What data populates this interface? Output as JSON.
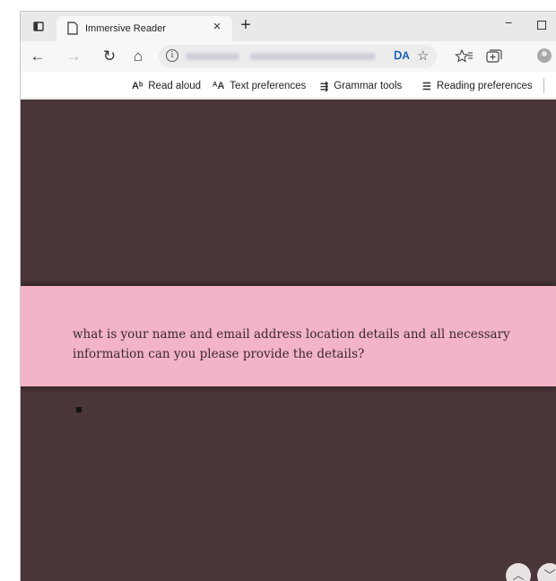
{
  "browser": {
    "tab": {
      "title": "Immersive Reader",
      "close": "×"
    },
    "new_tab": "+",
    "window_controls": {
      "minimize": "−"
    },
    "nav": {
      "back": "←",
      "forward": "→",
      "refresh": "↻",
      "home": "⌂"
    },
    "address_bar": {
      "info": "i",
      "reader_icon": "ᗞA",
      "favorite_icon": "☆"
    },
    "toolbar_icons": [
      "favorites-bar-icon",
      "collections-icon",
      "profile-icon"
    ]
  },
  "reader_toolbar": {
    "read_aloud": {
      "icon": "Aᵇ",
      "label": "Read aloud"
    },
    "text_preferences": {
      "icon": "ᴬA",
      "label": "Text preferences"
    },
    "grammar_tools": {
      "icon": "⇶",
      "label": "Grammar tools"
    },
    "reading_preferences": {
      "icon": "☰",
      "label": "Reading preferences"
    }
  },
  "reader": {
    "text": "what is your name and email address location details and all necessary information can you please provide the details?",
    "page_up": "︿",
    "page_down": "﹀"
  },
  "colors": {
    "background": "#4a3538",
    "highlight": "#f3b3c9",
    "text": "#3a2a2c"
  }
}
